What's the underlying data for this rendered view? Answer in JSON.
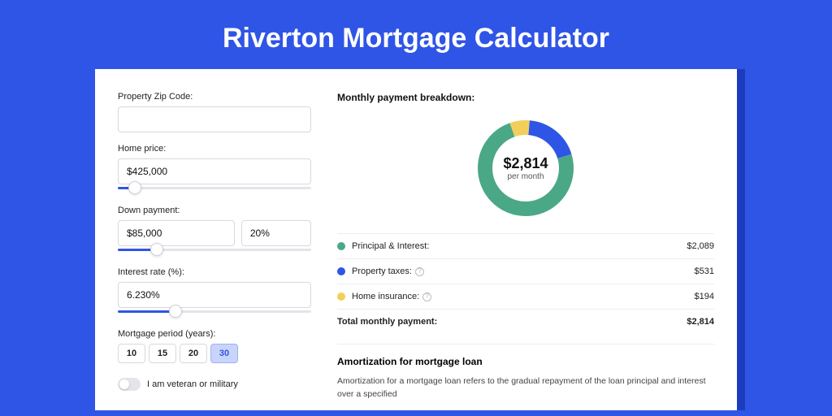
{
  "title": "Riverton Mortgage Calculator",
  "form": {
    "zip_label": "Property Zip Code:",
    "zip_value": "",
    "home_price_label": "Home price:",
    "home_price_value": "$425,000",
    "home_price_slider_pct": 9,
    "down_payment_label": "Down payment:",
    "down_payment_value": "$85,000",
    "down_payment_pct_value": "20%",
    "down_payment_slider_pct": 20,
    "interest_label": "Interest rate (%):",
    "interest_value": "6.230%",
    "interest_slider_pct": 30,
    "period_label": "Mortgage period (years):",
    "periods": [
      "10",
      "15",
      "20",
      "30"
    ],
    "period_active_index": 3,
    "veteran_label": "I am veteran or military"
  },
  "breakdown": {
    "title": "Monthly payment breakdown:",
    "total_display": "$2,814",
    "total_sub": "per month",
    "items": [
      {
        "label": "Principal & Interest:",
        "value": "$2,089",
        "color": "#4aa886",
        "has_info": false,
        "numeric": 2089
      },
      {
        "label": "Property taxes:",
        "value": "$531",
        "color": "#2f55e6",
        "has_info": true,
        "numeric": 531
      },
      {
        "label": "Home insurance:",
        "value": "$194",
        "color": "#f2cf5b",
        "has_info": true,
        "numeric": 194
      }
    ],
    "total_label": "Total monthly payment:",
    "total_value": "$2,814"
  },
  "amortization": {
    "title": "Amortization for mortgage loan",
    "text": "Amortization for a mortgage loan refers to the gradual repayment of the loan principal and interest over a specified"
  },
  "chart_data": {
    "type": "pie",
    "title": "Monthly payment breakdown",
    "series": [
      {
        "name": "Principal & Interest",
        "value": 2089,
        "color": "#4aa886"
      },
      {
        "name": "Property taxes",
        "value": 531,
        "color": "#2f55e6"
      },
      {
        "name": "Home insurance",
        "value": 194,
        "color": "#f2cf5b"
      }
    ],
    "total": 2814,
    "center_label": "$2,814 per month"
  }
}
